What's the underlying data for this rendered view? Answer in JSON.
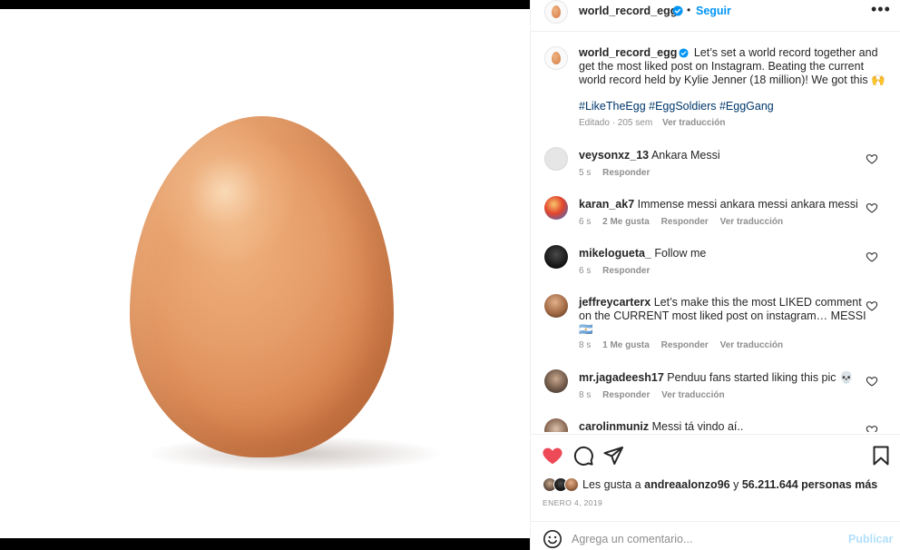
{
  "post": {
    "username": "world_record_egg",
    "follow_label": "Seguir",
    "separator": "•",
    "more_icon": "more-horizontal-icon",
    "caption": {
      "username": "world_record_egg",
      "text": "Let’s set a world record together and get the most liked post on Instagram. Beating the current world record held by Kylie Jenner (18 million)! We got this 🙌",
      "hashtags": "#LikeTheEgg #EggSoldiers #EggGang",
      "edited": "Editado · 205 sem",
      "translate": "Ver traducción"
    }
  },
  "comments": [
    {
      "username": "veysonxz_13",
      "text": "Ankara Messi",
      "time": "5 s",
      "likes": "",
      "reply": "Responder",
      "translate": ""
    },
    {
      "username": "karan_ak7",
      "text": "Immense messi ankara messi ankara messi",
      "time": "6 s",
      "likes": "2 Me gusta",
      "reply": "Responder",
      "translate": "Ver traducción"
    },
    {
      "username": "mikelogueta_",
      "text": "Follow me",
      "time": "6 s",
      "likes": "",
      "reply": "Responder",
      "translate": ""
    },
    {
      "username": "jeffreycarterx",
      "text": "Let’s make this the most LIKED comment on the CURRENT most liked post on instagram… MESSI 🇦🇷",
      "time": "8 s",
      "likes": "1 Me gusta",
      "reply": "Responder",
      "translate": "Ver traducción"
    },
    {
      "username": "mr.jagadeesh17",
      "text": "Penduu fans started liking this pic 💀",
      "time": "8 s",
      "likes": "",
      "reply": "Responder",
      "translate": "Ver traducción"
    },
    {
      "username": "carolinmuniz",
      "text": "Messi tá vindo aí..",
      "time": "",
      "likes": "",
      "reply": "",
      "translate": ""
    }
  ],
  "likes": {
    "prefix": "Les gusta a",
    "user": "andreaalonzo96",
    "conj": "y",
    "count": "56.211.644 personas más"
  },
  "date": "ENERO 4, 2019",
  "composer": {
    "placeholder": "Agrega un comentario...",
    "publish": "Publicar"
  },
  "colors": {
    "accent": "#0095f6",
    "like_red": "#ed4956",
    "hashtag": "#00376b",
    "muted": "#8e8e8e"
  }
}
